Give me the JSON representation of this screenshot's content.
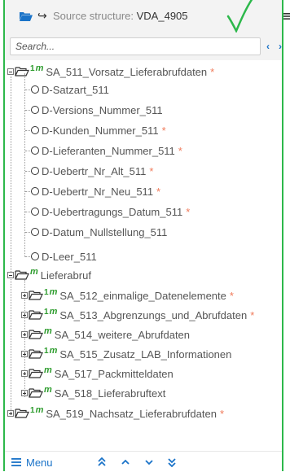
{
  "header": {
    "title_prefix": "Source structure:",
    "title_value": "VDA_4905",
    "menu_icon": "hamburger-icon"
  },
  "search": {
    "placeholder": "Search...",
    "prev_label": "‹",
    "next_label": "›"
  },
  "tree": {
    "badge_one": "1",
    "badge_m": "m",
    "items": [
      {
        "label": "SA_511_Vorsatz_Lieferabrufdaten",
        "required": "*"
      },
      {
        "label": "D-Satzart_511",
        "required": ""
      },
      {
        "label": "D-Versions_Nummer_511",
        "required": ""
      },
      {
        "label": "D-Kunden_Nummer_511",
        "required": "*"
      },
      {
        "label": "D-Lieferanten_Nummer_511",
        "required": "*"
      },
      {
        "label": "D-Uebertr_Nr_Alt_511",
        "required": "*"
      },
      {
        "label": "D-Uebertr_Nr_Neu_511",
        "required": "*"
      },
      {
        "label": "D-Uebertragungs_Datum_511",
        "required": "*"
      },
      {
        "label": "D-Datum_Nullstellung_511",
        "required": ""
      },
      {
        "label": "D-Leer_511",
        "required": ""
      },
      {
        "label": "Lieferabruf",
        "required": ""
      },
      {
        "label": "SA_512_einmalige_Datenelemente",
        "required": "*"
      },
      {
        "label": "SA_513_Abgrenzungs_und_Abrufdaten",
        "required": "*"
      },
      {
        "label": "SA_514_weitere_Abrufdaten",
        "required": ""
      },
      {
        "label": "SA_515_Zusatz_LAB_Informationen",
        "required": ""
      },
      {
        "label": "SA_517_Packmitteldaten",
        "required": ""
      },
      {
        "label": "SA_518_Lieferabruftext",
        "required": ""
      },
      {
        "label": "SA_519_Nachsatz_Lieferabrufdaten",
        "required": "*"
      }
    ]
  },
  "footer": {
    "menu_label": "Menu",
    "btn_first": "«",
    "btn_up": "‹",
    "btn_down": "›",
    "btn_last": "»"
  },
  "colors": {
    "accent": "#1a73c8",
    "badge_green": "#2d9c2d",
    "required": "#f07a5a",
    "annotation_green": "#2db84b"
  }
}
